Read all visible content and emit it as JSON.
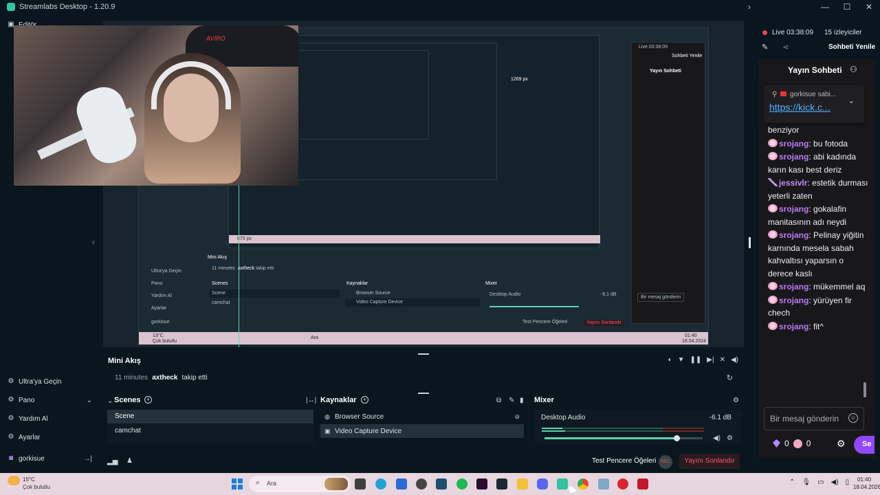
{
  "window": {
    "title": "Streamlabs Desktop - 1.20.9",
    "controls": [
      "—",
      "☐",
      "✕"
    ]
  },
  "sidebar": {
    "editor_label": "Editör",
    "items": [
      {
        "label": "Ultra'ya Geçin",
        "icon": "ultra-icon"
      },
      {
        "label": "Pano",
        "icon": "dashboard-icon",
        "trail": "⌄"
      },
      {
        "label": "Yardım Al",
        "icon": "help-icon"
      },
      {
        "label": "Ayarlar",
        "icon": "settings-icon"
      },
      {
        "label": "gorkisue",
        "icon": "user-icon",
        "trail": "→|"
      }
    ]
  },
  "preview": {
    "mock_labels": {
      "mini": "Mini Akış",
      "minutes": "11 minutes",
      "user": "axtheck",
      "action": "takip etti",
      "scenes": "Scenes",
      "scene": "Scene",
      "camchat": "camchat",
      "sources": "Kaynaklar",
      "browser": "Browser Source",
      "video": "Video Capture Device",
      "mixer": "Mixer",
      "desktop": "Desktop Audio",
      "db": "-6.1 dB",
      "test": "Test Pencere Öğeleri",
      "end": "Yayını Sonlandır",
      "chat_title": "Yayın Sohbeti",
      "refresh": "Sohbeti Yenile",
      "live": "Live 03:38:09",
      "viewers": "15 izleyiciler",
      "input": "Bir mesaj gönderin",
      "px1": "1269 px",
      "px2": "675 px",
      "ultra": "Ultra'ya Geçin",
      "pano": "Pano",
      "yardim": "Yardım Al",
      "ayarlar": "Ayarlar",
      "user2": "gorkisue",
      "temp": "13°C",
      "weather": "Çok bulutlu",
      "ara": "Ara",
      "time": "01:40",
      "date": "18.04.2024"
    },
    "webcam_logo": "AVIRO"
  },
  "mini_feed": {
    "title": "Mini Akış",
    "time": "11 minutes",
    "user": "axtheck",
    "action": "takip etti"
  },
  "scenes": {
    "title": "Scenes",
    "items": [
      "Scene",
      "camchat"
    ]
  },
  "sources": {
    "title": "Kaynaklar",
    "items": [
      "Browser Source",
      "Video Capture Device"
    ]
  },
  "mixer": {
    "title": "Mixer",
    "channel": "Desktop Audio",
    "db": "-6.1 dB",
    "volume_pct": 83
  },
  "footer": {
    "test_widgets": "Test Pencere Öğeleri",
    "rec": "REC",
    "end_stream": "Yayını Sonlandır"
  },
  "chat": {
    "live": "Live 03:38:09",
    "viewers": "15 izleyiciler",
    "refresh": "Sohbeti Yenile",
    "title": "Yayın Sohbeti",
    "pinned_by": "gorkisue sabi...",
    "pinned_link": "https://kick.c...",
    "messages": [
      {
        "badge": "none",
        "nick": "",
        "text": "benziyor"
      },
      {
        "badge": "flower",
        "nick": "srojang",
        "text": "bu fotoda"
      },
      {
        "badge": "flower",
        "nick": "srojang",
        "text": "abi kadında karın kası best deriz"
      },
      {
        "badge": "sword",
        "nick": "jessivlr",
        "text": "estetik durması yeterli zaten"
      },
      {
        "badge": "flower",
        "nick": "srojang",
        "text": "gokalafin manitasının adı neydi"
      },
      {
        "badge": "flower",
        "nick": "srojang",
        "text": "Pelinay yiğitin karnında mesela sabah kahvaltısı yaparsın o derece kaslı"
      },
      {
        "badge": "flower",
        "nick": "srojang",
        "text": "mükemmel aq"
      },
      {
        "badge": "flower",
        "nick": "srojang",
        "text": "yürüyen fir chech"
      },
      {
        "badge": "flower",
        "nick": "srojang",
        "text": "fit^"
      }
    ],
    "input_placeholder": "Bir mesaj gönderin",
    "gems": "0",
    "points": "0",
    "send": "Se"
  },
  "taskbar": {
    "temp": "15°C",
    "weather": "Çok bulutlu",
    "search": "Ara",
    "time": "01:40",
    "date": "18.04.2026",
    "apps": [
      "file-explorer",
      "edge",
      "store",
      "chatgpt",
      "app",
      "spotify",
      "epic",
      "steam",
      "discord",
      "folder",
      "streamlabs",
      "chrome",
      "tool",
      "app-red",
      "app-red2"
    ]
  },
  "colors": {
    "accent": "#31c3a2",
    "bg": "#09161d",
    "panel": "#17242d",
    "chat": "#18181b",
    "nick": "#b97bf2",
    "link": "#53b3ff",
    "end": "#ff5566",
    "kick_send": "#9147ff"
  }
}
